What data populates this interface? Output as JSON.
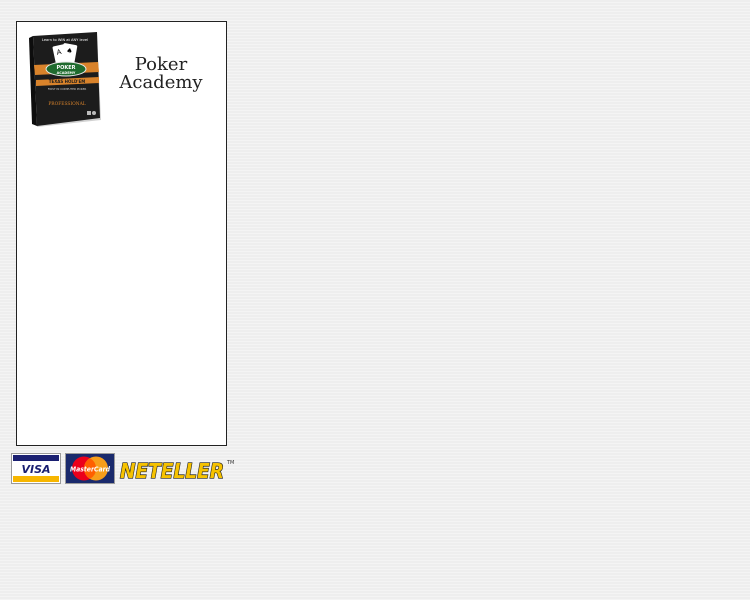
{
  "product": {
    "name_line1": "Poker",
    "name_line2": "Academy",
    "box": {
      "banner": "Learn to WIN at ANY level",
      "brand_top": "POKER",
      "brand_bottom": "ACADEMY",
      "edition_strip": "TEXAS HOLD'EM",
      "tagline": "FIRST IN COMPUTER POKER",
      "edition": "PROFESSIONAL"
    }
  },
  "payments": {
    "visa": "VISA",
    "mastercard": "MasterCard",
    "neteller": "NETELLER",
    "tm": "TM"
  },
  "colors": {
    "background": "#eeeeee",
    "panel": "#ffffff",
    "box_dark": "#1c1c1c",
    "box_orange": "#d9832b",
    "box_green": "#1f6b2e",
    "visa_blue": "#1a1f71",
    "visa_gold": "#f7b600",
    "mc_red": "#eb001b",
    "mc_orange": "#f79e1b",
    "neteller_yellow": "#f6c200"
  }
}
